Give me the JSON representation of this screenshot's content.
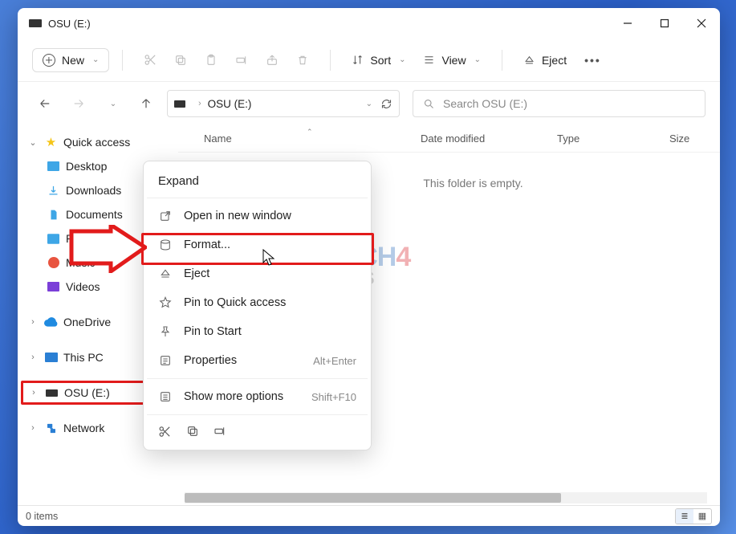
{
  "titlebar": {
    "title": "OSU (E:)"
  },
  "toolbar": {
    "new_label": "New",
    "sort_label": "Sort",
    "view_label": "View",
    "eject_label": "Eject"
  },
  "breadcrumb": {
    "current": "OSU (E:)"
  },
  "search": {
    "placeholder": "Search OSU (E:)"
  },
  "columns": {
    "name": "Name",
    "date": "Date modified",
    "type": "Type",
    "size": "Size"
  },
  "list": {
    "empty_message": "This folder is empty."
  },
  "sidebar": {
    "quick_access": "Quick access",
    "items": [
      {
        "label": "Desktop"
      },
      {
        "label": "Downloads"
      },
      {
        "label": "Documents"
      },
      {
        "label": "Pictures"
      },
      {
        "label": "Music"
      },
      {
        "label": "Videos"
      }
    ],
    "onedrive": "OneDrive",
    "thispc": "This PC",
    "drive": "OSU (E:)",
    "network": "Network"
  },
  "context_menu": {
    "header": "Expand",
    "open_new_window": "Open in new window",
    "format": "Format...",
    "eject": "Eject",
    "pin_quick": "Pin to Quick access",
    "pin_start": "Pin to Start",
    "properties": "Properties",
    "properties_shortcut": "Alt+Enter",
    "show_more": "Show more options",
    "show_more_shortcut": "Shift+F10"
  },
  "statusbar": {
    "items": "0 items"
  },
  "watermark": {
    "line1a": "TECH",
    "line1b": "4",
    "line2": "GAMERS"
  }
}
